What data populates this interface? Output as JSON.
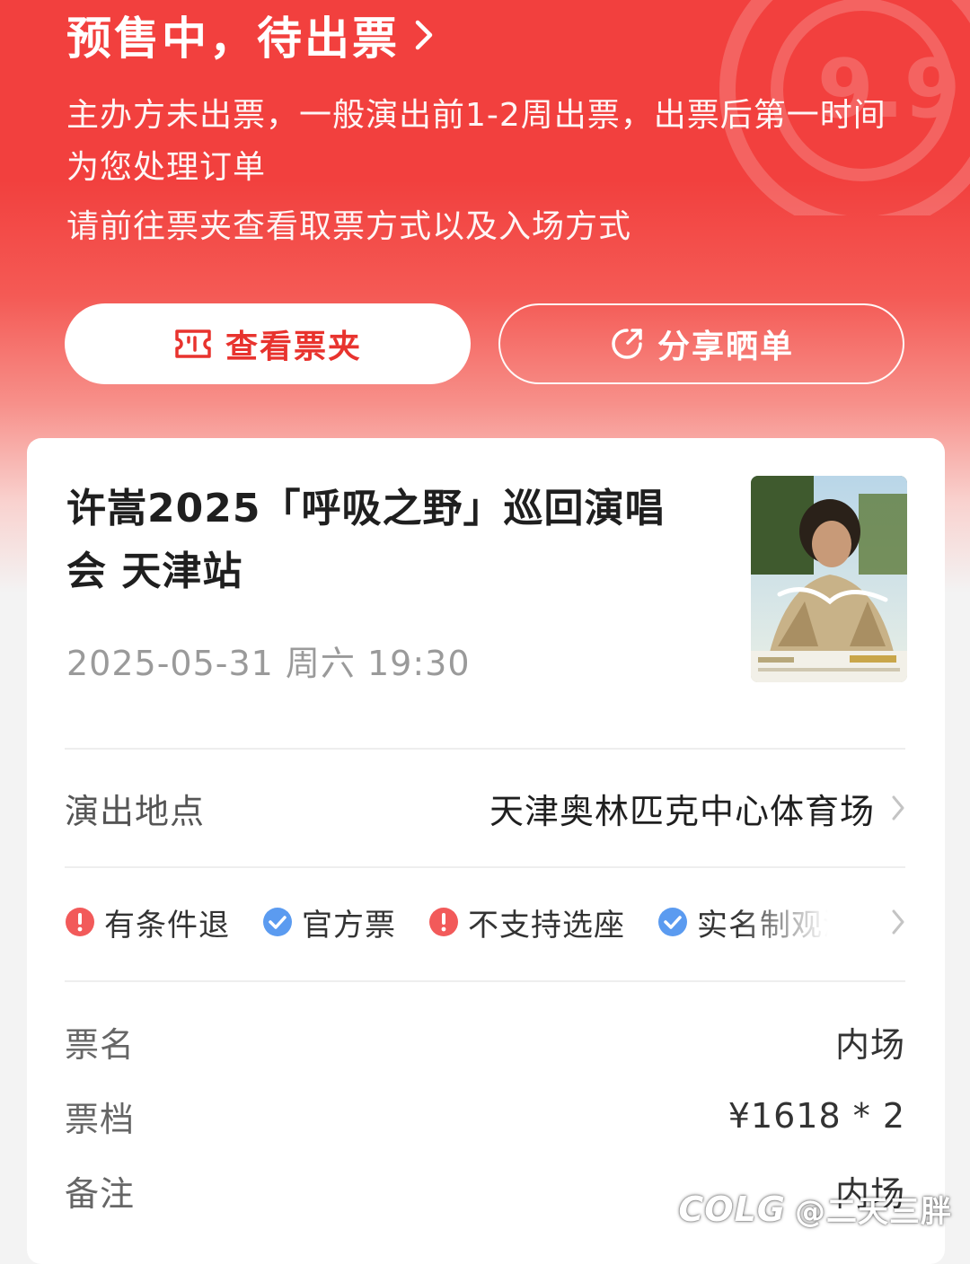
{
  "header": {
    "status_title": "预售中，待出票",
    "desc_line1": "主办方未出票，一般演出前1-2周出票，出票后第一时间为您处理订单",
    "desc_line2": "请前往票夹查看取票方式以及入场方式"
  },
  "actions": {
    "view_tickets_label": "查看票夹",
    "share_label": "分享晒单"
  },
  "show": {
    "title": "许嵩2025「呼吸之野」巡回演唱会 天津站",
    "datetime": "2025-05-31 周六 19:30"
  },
  "venue": {
    "label": "演出地点",
    "value": "天津奥林匹克中心体育场"
  },
  "tags": [
    {
      "text": "有条件退",
      "icon": "warning-icon"
    },
    {
      "text": "官方票",
      "icon": "check-icon"
    },
    {
      "text": "不支持选座",
      "icon": "warning-icon"
    },
    {
      "text": "实名制观演",
      "icon": "check-icon"
    }
  ],
  "ticket": {
    "name_label": "票名",
    "name_value": "内场",
    "tier_label": "票档",
    "tier_value": "¥1618 * 2",
    "note_label": "备注",
    "note_value": "内场"
  },
  "watermark": {
    "logo": "COLG",
    "handle": "@二天三胖"
  },
  "colors": {
    "primary_red": "#f2403e",
    "warning_red": "#f25a5a",
    "check_blue": "#5b9bf0"
  }
}
